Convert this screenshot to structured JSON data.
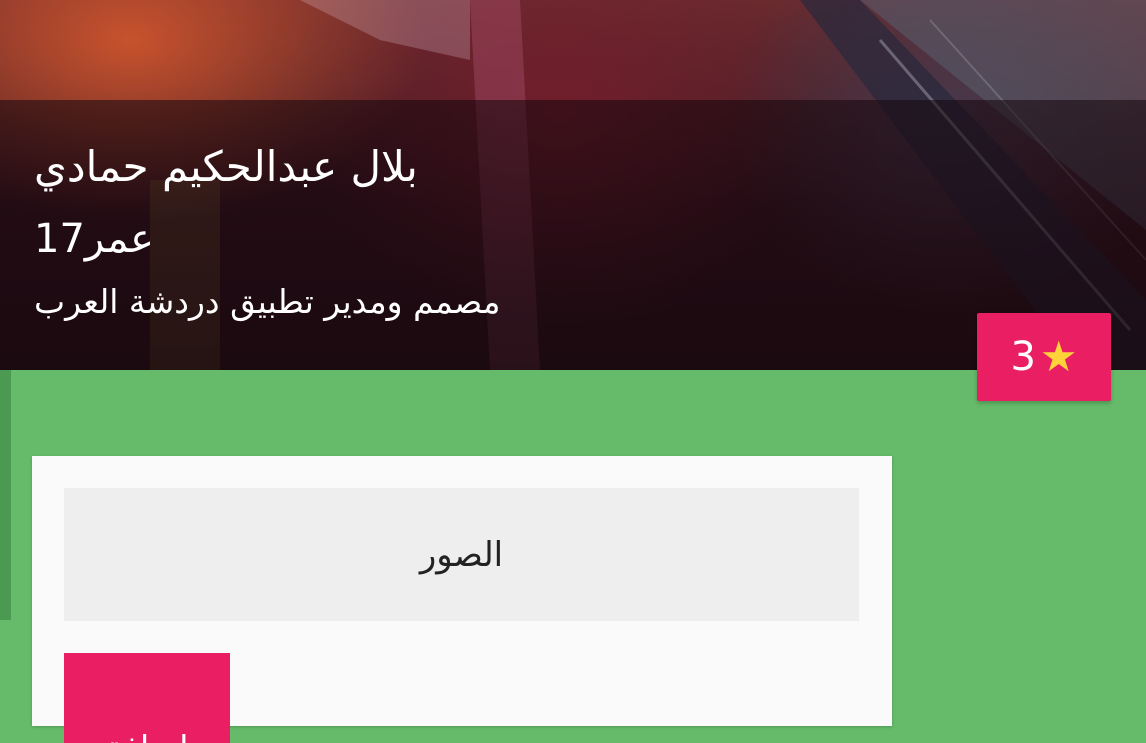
{
  "profile": {
    "name": "بلال عبدالحكيم حمادي",
    "age": "17عمر",
    "bio": "مصمم ومدير تطبيق دردشة العرب",
    "stars": "3",
    "star_icon": "star-icon"
  },
  "photos": {
    "title": "الصور",
    "add_label": "إضافة"
  },
  "colors": {
    "background": "#65bb6a",
    "accent": "#e91e63",
    "star": "#ffd23a",
    "card": "#fafafa"
  }
}
